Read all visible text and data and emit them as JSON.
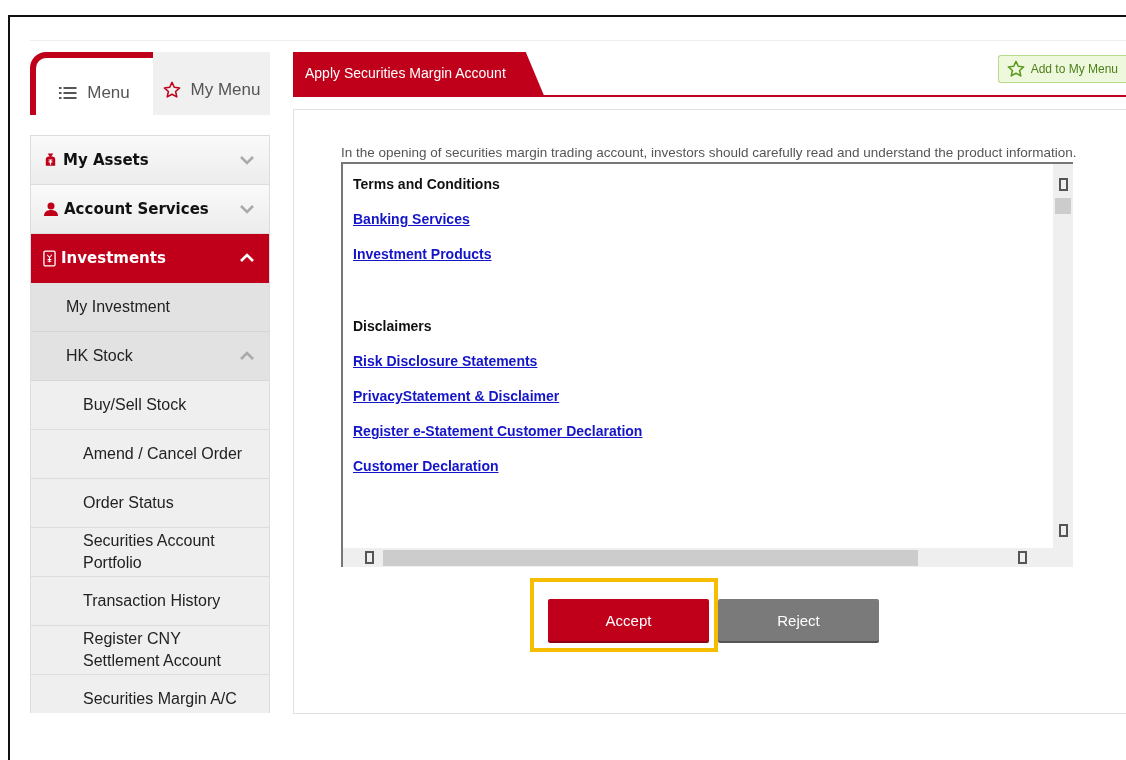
{
  "sidebar": {
    "tabs": [
      {
        "label": "Menu",
        "selected": true
      },
      {
        "label": "My Menu",
        "selected": false
      }
    ],
    "items": [
      {
        "label": "My Assets",
        "expanded": false,
        "selected": false
      },
      {
        "label": "Account Services",
        "expanded": false,
        "selected": false
      },
      {
        "label": "Investments",
        "expanded": true,
        "selected": true,
        "children": [
          {
            "label": "My Investment"
          },
          {
            "label": "HK Stock",
            "expanded": true,
            "children": [
              {
                "label": "Buy/Sell Stock"
              },
              {
                "label": "Amend / Cancel Order"
              },
              {
                "label": "Order Status"
              },
              {
                "label": "Securities Account Portfolio"
              },
              {
                "label": "Transaction History"
              },
              {
                "label": "Register CNY Settlement Account"
              },
              {
                "label": "Securities Margin A/C"
              }
            ]
          }
        ]
      }
    ]
  },
  "page": {
    "title": "Apply Securities Margin Account",
    "add_button": "Add to My Menu",
    "intro": "In the opening of securities margin trading account, investors should carefully read and understand the product information.",
    "sections": [
      {
        "heading": "Terms and Conditions",
        "links": [
          "Banking Services",
          "Investment Products"
        ]
      },
      {
        "heading": "Disclaimers",
        "links": [
          "Risk Disclosure Statements",
          "PrivacyStatement & Disclaimer ",
          "Register e-Statement Customer Declaration",
          "Customer Declaration"
        ]
      }
    ],
    "buttons": [
      {
        "label": "Accept",
        "kind": "primary",
        "highlighted": true
      },
      {
        "label": "Reject",
        "kind": "secondary",
        "highlighted": false
      }
    ]
  }
}
